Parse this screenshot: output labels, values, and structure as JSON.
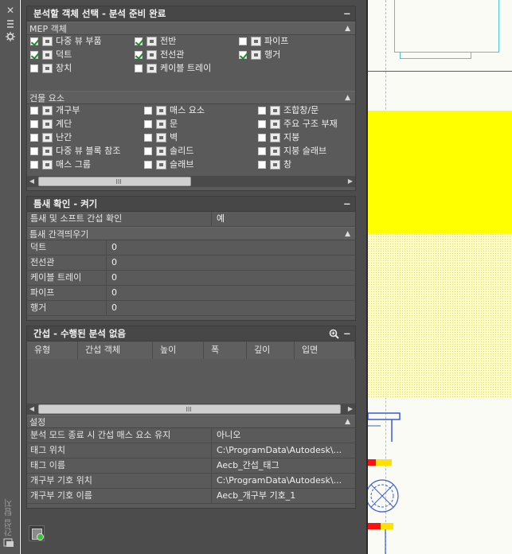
{
  "strip": {
    "close_glyph": "✕",
    "vertical_title": "간섭 탐지"
  },
  "panel_selection": {
    "title": "분석할 객체 선택 - 분석 준비 완료",
    "mep_header": "MEP 객체",
    "mep_items": [
      {
        "label": "다중 뷰 부품",
        "checked": true,
        "icon": "multi-view-part-icon"
      },
      {
        "label": "전반",
        "checked": true,
        "icon": "panel-board-icon"
      },
      {
        "label": "파이프",
        "checked": false,
        "icon": "pipe-icon"
      },
      {
        "label": "덕트",
        "checked": true,
        "icon": "duct-icon"
      },
      {
        "label": "전선관",
        "checked": true,
        "icon": "conduit-icon"
      },
      {
        "label": "행거",
        "checked": true,
        "icon": "hanger-icon"
      },
      {
        "label": "장치",
        "checked": false,
        "icon": "device-icon"
      },
      {
        "label": "케이블 트레이",
        "checked": false,
        "icon": "cable-tray-icon"
      }
    ],
    "building_header": "건물 요소",
    "building_items": [
      {
        "label": "개구부",
        "checked": false,
        "icon": "opening-icon"
      },
      {
        "label": "매스 요소",
        "checked": false,
        "icon": "mass-element-icon"
      },
      {
        "label": "조합창/문",
        "checked": false,
        "icon": "door-window-assembly-icon"
      },
      {
        "label": "계단",
        "checked": false,
        "icon": "stair-icon"
      },
      {
        "label": "문",
        "checked": false,
        "icon": "door-icon"
      },
      {
        "label": "주요 구조 부재",
        "checked": false,
        "icon": "structural-member-icon"
      },
      {
        "label": "난간",
        "checked": false,
        "icon": "railing-icon"
      },
      {
        "label": "벽",
        "checked": false,
        "icon": "wall-icon"
      },
      {
        "label": "지붕",
        "checked": false,
        "icon": "roof-icon"
      },
      {
        "label": "다중 뷰 블록 참조",
        "checked": false,
        "icon": "multi-view-block-icon"
      },
      {
        "label": "솔리드",
        "checked": false,
        "icon": "solid-icon"
      },
      {
        "label": "지붕 슬래브",
        "checked": false,
        "icon": "roof-slab-icon"
      },
      {
        "label": "매스 그룹",
        "checked": false,
        "icon": "mass-group-icon"
      },
      {
        "label": "슬래브",
        "checked": false,
        "icon": "slab-icon"
      },
      {
        "label": "창",
        "checked": false,
        "icon": "window-icon"
      }
    ],
    "scroll_grip": "III"
  },
  "panel_tolerance": {
    "title": "틈새 확인 - 켜기",
    "row_key": "틈새 및 소프트 간섭 확인",
    "row_value": "예",
    "spacing_header": "틈새 간격띄우기",
    "rows": [
      {
        "key": "덕트",
        "value": "0"
      },
      {
        "key": "전선관",
        "value": "0"
      },
      {
        "key": "케이블 트레이",
        "value": "0"
      },
      {
        "key": "파이프",
        "value": "0"
      },
      {
        "key": "행거",
        "value": "0"
      }
    ]
  },
  "panel_results": {
    "title": "간섭 - 수행된 분석 없음",
    "columns": [
      "유형",
      "간섭 객체",
      "높이",
      "폭",
      "깊이",
      "입면"
    ],
    "scroll_grip": "III",
    "settings_header": "설정",
    "settings": [
      {
        "key": "분석 모드 종료 시 간섭 매스 요소 유지",
        "value": "아니오"
      },
      {
        "key": "태그 위치",
        "value": "C:\\ProgramData\\Autodesk\\..."
      },
      {
        "key": "태그 이름",
        "value": "Aecb_간섭_태그"
      },
      {
        "key": "개구부 기호 위치",
        "value": "C:\\ProgramData\\Autodesk\\..."
      },
      {
        "key": "개구부 기호 이름",
        "value": "Aecb_개구부 기호_1"
      }
    ]
  },
  "colors": {
    "palette_bg": "#4c4c4c",
    "panel_bg": "#5a5a5a",
    "checkmark": "#1d8a2a",
    "cad_yellow": "#ffff00",
    "cad_cyan": "#4ac8d8",
    "cad_purple": "#8a3a9a"
  }
}
